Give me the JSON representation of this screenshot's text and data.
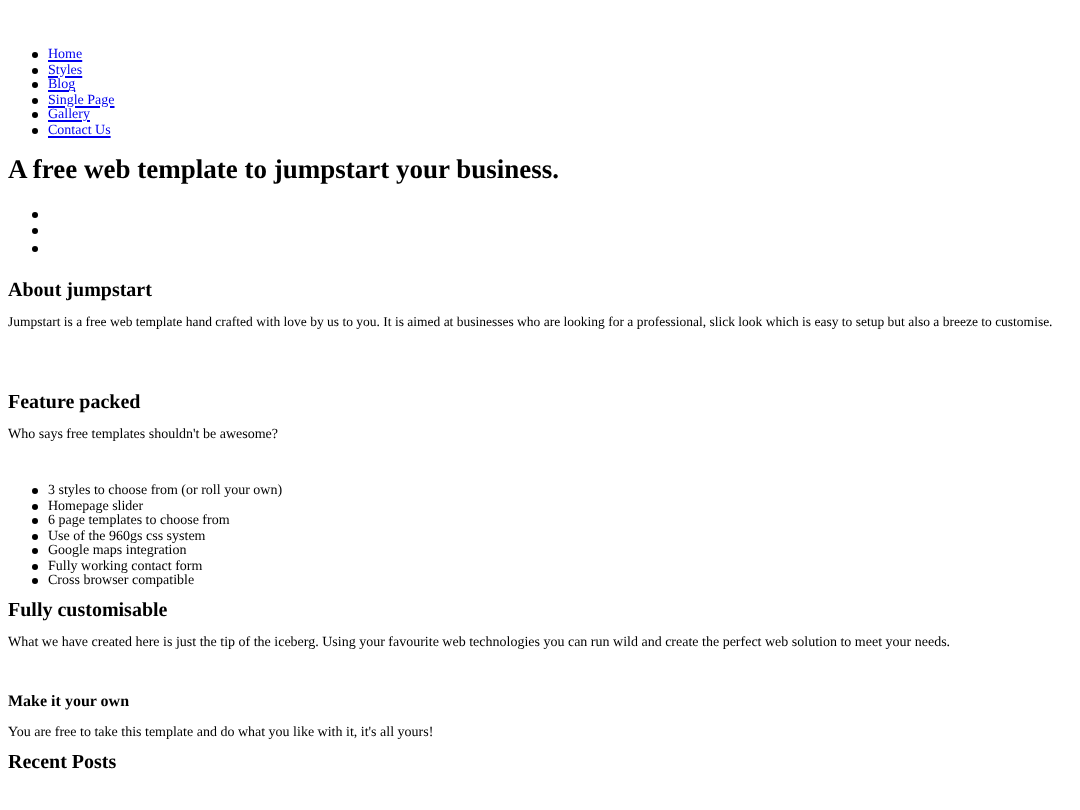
{
  "nav": [
    "Home",
    "Styles",
    "Blog",
    "Single Page",
    "Gallery",
    "Contact Us"
  ],
  "title": "A free web template to jumpstart your business.",
  "slider_items": [
    {
      "kind": "empty"
    },
    {
      "kind": "empty"
    },
    {
      "kind": "empty"
    }
  ],
  "about": {
    "heading": "About jumpstart",
    "text": "Jumpstart is a free web template hand crafted with love by us to you. It is aimed at businesses who are looking for a professional, slick look which is easy to setup but also a breeze to customise."
  },
  "features": {
    "heading": "Feature packed",
    "text": "Who says free templates shouldn't be awesome?",
    "items": [
      "3 styles to choose from (or roll your own)",
      "Homepage slider",
      "6 page templates to choose from",
      "Use of the 960gs css system",
      "Google maps integration",
      "Fully working contact form",
      "Cross browser compatible"
    ]
  },
  "customise": {
    "heading": "Fully customisable",
    "text": "What we have created here is just the tip of the iceberg. Using your favourite web technologies you can run wild and create the perfect web solution to meet your needs."
  },
  "own": {
    "heading": "Make it your own",
    "text": "You are free to take this template and do what you like with it, it's all yours!"
  },
  "recent": {
    "heading": "Recent Posts"
  }
}
